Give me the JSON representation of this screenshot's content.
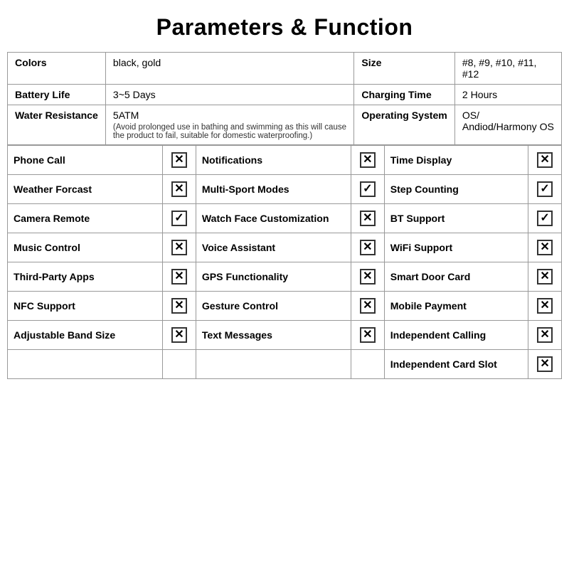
{
  "title": "Parameters & Function",
  "params": {
    "row1": {
      "col1_label": "Colors",
      "col1_value": "black, gold",
      "col2_label": "Size",
      "col2_value": "#8, #9, #10, #11, #12"
    },
    "row2": {
      "col1_label": "Battery Life",
      "col1_value": "3~5 Days",
      "col2_label": "Charging Time",
      "col2_value": "2 Hours"
    },
    "row3": {
      "col1_label": "Water Resistance",
      "col1_value": "5ATM",
      "col1_note": "(Avoid prolonged use in bathing and swimming as this will cause the product to fail, suitable for domestic waterproofing.)",
      "col2_label": "Operating System",
      "col2_value": "OS/ Andiod/Harmony OS"
    }
  },
  "features": [
    {
      "col1_name": "Phone Call",
      "col1_icon": "x",
      "col2_name": "Notifications",
      "col2_icon": "x",
      "col3_name": "Time Display",
      "col3_icon": "x"
    },
    {
      "col1_name": "Weather Forcast",
      "col1_icon": "x",
      "col2_name": "Multi-Sport Modes",
      "col2_icon": "v",
      "col3_name": "Step Counting",
      "col3_icon": "v"
    },
    {
      "col1_name": "Camera Remote",
      "col1_icon": "v",
      "col2_name": "Watch Face Customization",
      "col2_icon": "x",
      "col3_name": "BT Support",
      "col3_icon": "v"
    },
    {
      "col1_name": "Music Control",
      "col1_icon": "x",
      "col2_name": "Voice Assistant",
      "col2_icon": "x",
      "col3_name": "WiFi Support",
      "col3_icon": "x"
    },
    {
      "col1_name": "Third-Party Apps",
      "col1_icon": "x",
      "col2_name": "GPS Functionality",
      "col2_icon": "x",
      "col3_name": "Smart Door Card",
      "col3_icon": "x"
    },
    {
      "col1_name": "NFC Support",
      "col1_icon": "x",
      "col2_name": "Gesture Control",
      "col2_icon": "x",
      "col3_name": "Mobile Payment",
      "col3_icon": "x"
    },
    {
      "col1_name": "Adjustable Band Size",
      "col1_icon": "x",
      "col2_name": "Text Messages",
      "col2_icon": "x",
      "col3_name": "Independent Calling",
      "col3_icon": "x"
    },
    {
      "col1_name": "",
      "col1_icon": "",
      "col2_name": "",
      "col2_icon": "",
      "col3_name": "Independent Card Slot",
      "col3_icon": "x"
    }
  ],
  "icons": {
    "x": "&#x2612;",
    "v": "&#x2611;"
  }
}
